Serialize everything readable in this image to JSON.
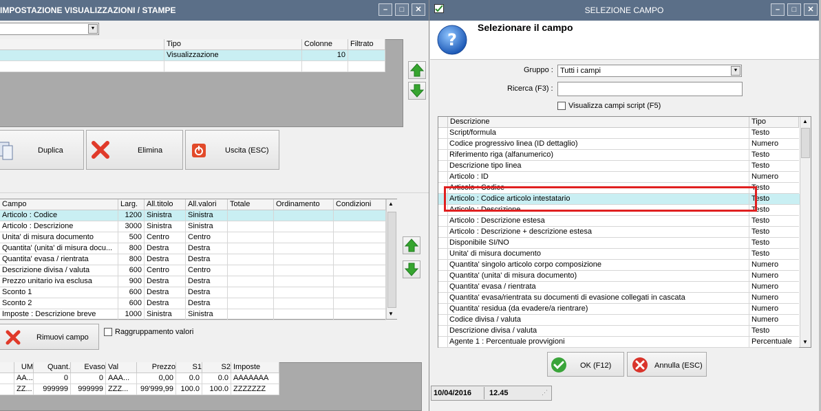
{
  "left": {
    "title": "IMPOSTAZIONE VISUALIZZAZIONI / STAMPE",
    "top_grid": {
      "headers": [
        "Tipo",
        "Colonne",
        "Filtrato"
      ],
      "row": [
        "Visualizzazione",
        "10",
        ""
      ]
    },
    "buttons": {
      "duplica": "Duplica",
      "elimina": "Elimina",
      "uscita": "Uscita (ESC)",
      "rimuovi": "Rimuovi campo"
    },
    "checkbox_label": "Raggruppamento valori",
    "fields_grid": {
      "headers": [
        "Campo",
        "Larg.",
        "All.titolo",
        "All.valori",
        "Totale",
        "Ordinamento",
        "Condizioni"
      ],
      "rows": [
        [
          "Articolo : Codice",
          "1200",
          "Sinistra",
          "Sinistra"
        ],
        [
          "Articolo : Descrizione",
          "3000",
          "Sinistra",
          "Sinistra"
        ],
        [
          "Unita' di misura documento",
          "500",
          "Centro",
          "Centro"
        ],
        [
          "Quantita' (unita' di misura docu...",
          "800",
          "Destra",
          "Destra"
        ],
        [
          "Quantita' evasa / rientrata",
          "800",
          "Destra",
          "Destra"
        ],
        [
          "Descrizione divisa / valuta",
          "600",
          "Centro",
          "Centro"
        ],
        [
          "Prezzo unitario iva esclusa",
          "900",
          "Destra",
          "Destra"
        ],
        [
          "Sconto 1",
          "600",
          "Destra",
          "Destra"
        ],
        [
          "Sconto 2",
          "600",
          "Destra",
          "Destra"
        ],
        [
          "Imposte : Descrizione breve",
          "1000",
          "Sinistra",
          "Sinistra"
        ]
      ]
    },
    "preview_grid": {
      "headers": [
        "UM",
        "Quant.",
        "Evaso",
        "Val",
        "Prezzo",
        "S1",
        "S2",
        "Imposte"
      ],
      "rows": [
        [
          "AA...",
          "0",
          "0",
          "AAA...",
          "0,00",
          "0.0",
          "0.0",
          "AAAAAAA"
        ],
        [
          "ZZ...",
          "999999",
          "999999",
          "ZZZ...",
          "99'999,99",
          "100.0",
          "100.0",
          "ZZZZZZZ"
        ]
      ]
    }
  },
  "right": {
    "title": "SELEZIONE CAMPO",
    "heading": "Selezionare il campo",
    "gruppo_label": "Gruppo :",
    "gruppo_value": "Tutti i campi",
    "ricerca_label": "Ricerca (F3) :",
    "ricerca_value": "",
    "script_checkbox_label": "Visualizza campi script (F5)",
    "grid_headers": [
      "Descrizione",
      "Tipo"
    ],
    "rows": [
      [
        "Script/formula",
        "Testo"
      ],
      [
        "Codice progressivo linea (ID dettaglio)",
        "Numero"
      ],
      [
        "Riferimento riga (alfanumerico)",
        "Testo"
      ],
      [
        "Descrizione tipo linea",
        "Testo"
      ],
      [
        "Articolo : ID",
        "Numero"
      ],
      [
        "Articolo : Codice",
        "Testo"
      ],
      [
        "Articolo : Codice articolo intestatario",
        "Testo"
      ],
      [
        "Articolo : Descrizione",
        "Testo"
      ],
      [
        "Articolo : Descrizione estesa",
        "Testo"
      ],
      [
        "Articolo : Descrizione + descrizione estesa",
        "Testo"
      ],
      [
        "Disponibile SI/NO",
        "Testo"
      ],
      [
        "Unita' di misura documento",
        "Testo"
      ],
      [
        "Quantita' singolo articolo corpo composizione",
        "Numero"
      ],
      [
        "Quantita' (unita' di misura documento)",
        "Numero"
      ],
      [
        "Quantita' evasa / rientrata",
        "Numero"
      ],
      [
        "Quantita' evasa/rientrata su documenti di evasione collegati in cascata",
        "Numero"
      ],
      [
        "Quantita' residua (da evadere/a rientrare)",
        "Numero"
      ],
      [
        "Codice divisa / valuta",
        "Numero"
      ],
      [
        "Descrizione divisa / valuta",
        "Testo"
      ],
      [
        "Agente 1 : Percentuale provvigioni",
        "Percentuale"
      ]
    ],
    "ok_label": "OK (F12)",
    "annulla_label": "Annulla (ESC)",
    "status_date": "10/04/2016",
    "status_time": "12.45"
  },
  "colors": {
    "titlebar": "#5b6f88",
    "selection": "#c9eff3",
    "highlight_box": "#e02020",
    "ok_green": "#3aa43a",
    "cancel_red": "#d9342b"
  }
}
